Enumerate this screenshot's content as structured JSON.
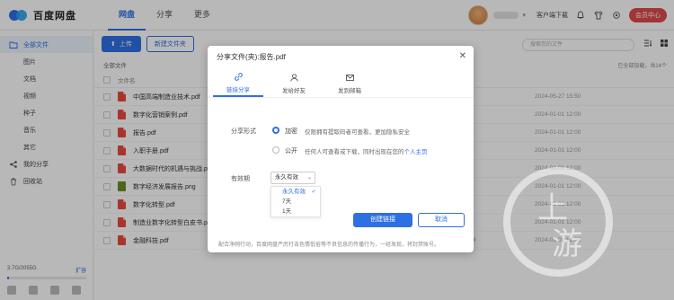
{
  "app": {
    "logo_text": "百度网盘"
  },
  "nav": {
    "tabs": [
      "网盘",
      "分享",
      "更多"
    ]
  },
  "topbar": {
    "links": [
      "客户端下载"
    ],
    "vip_label": "会员中心"
  },
  "sidebar": {
    "items": [
      {
        "label": "全部文件",
        "active": true
      },
      {
        "label": "图片"
      },
      {
        "label": "文档"
      },
      {
        "label": "视频"
      },
      {
        "label": "种子"
      },
      {
        "label": "音乐"
      },
      {
        "label": "其它"
      },
      {
        "label": "我的分享"
      },
      {
        "label": "回收站"
      }
    ],
    "storage_text": "3.7G/2055G",
    "storage_expand": "扩容",
    "storage_fraction": 0.002
  },
  "toolbar": {
    "upload_label": "上传",
    "new_folder_label": "新建文件夹",
    "search_placeholder": "搜索您的文件"
  },
  "breadcrumb": "全部文件",
  "loaded_text": "已全部加载，共14个",
  "table": {
    "header_name": "文件名",
    "rows": [
      {
        "name": "中国高端制造业技术.pdf",
        "time": "2024-05-27 15:50",
        "icon": "pdf"
      },
      {
        "name": "数字化营销案例.pdf",
        "time": "2024-01-01 12:00",
        "icon": "pdf"
      },
      {
        "name": "报告.pdf",
        "time": "2024-01-01 12:00",
        "icon": "pdf"
      },
      {
        "name": "入职手册.pdf",
        "time": "2024-01-01 12:00",
        "icon": "pdf"
      },
      {
        "name": "大数据时代的机遇与挑战.pdf",
        "time": "2024-01-01 12:00",
        "icon": "pdf"
      },
      {
        "name": "数字经济发展报告.png",
        "time": "2024-01-01 12:00",
        "icon": "img"
      },
      {
        "name": "数字化转型.pdf",
        "time": "2024-01-01 12:00",
        "icon": "pdf"
      },
      {
        "name": "制造业数字化转型白皮书.pdf",
        "time": "2024-01-01 12:00",
        "icon": "pdf"
      },
      {
        "name": "金融科技.pdf",
        "time": "2024-01-01 12:00",
        "icon": "pdf"
      }
    ],
    "last_size": "1.4M"
  },
  "modal": {
    "title": "分享文件(夹):报告.pdf",
    "tabs": [
      {
        "label": "链接分享",
        "active": true,
        "icon": "link-icon"
      },
      {
        "label": "发给好友",
        "icon": "friend-icon"
      },
      {
        "label": "发到邮箱",
        "icon": "mail-icon"
      }
    ],
    "share_form_label": "分享形式",
    "option_private": "加密",
    "option_private_desc": "仅限拥有提取码者可查看，更加隐私安全",
    "option_public": "公开",
    "option_public_desc_a": "任何人可查看或下载，同时出现在您的",
    "option_public_desc_link": "个人主页",
    "validity_label": "有效期",
    "validity_value": "永久有效",
    "validity_options": [
      "永久有效",
      "7天",
      "1天"
    ],
    "create_button": "创建链接",
    "cancel_button": "取消",
    "notice": "配合净网行动，百度网盘严厉打击色情低俗等不良信息的传播行为，一经发现，将封禁账号。"
  },
  "watermark": {
    "char1": "上",
    "char2": "游"
  }
}
